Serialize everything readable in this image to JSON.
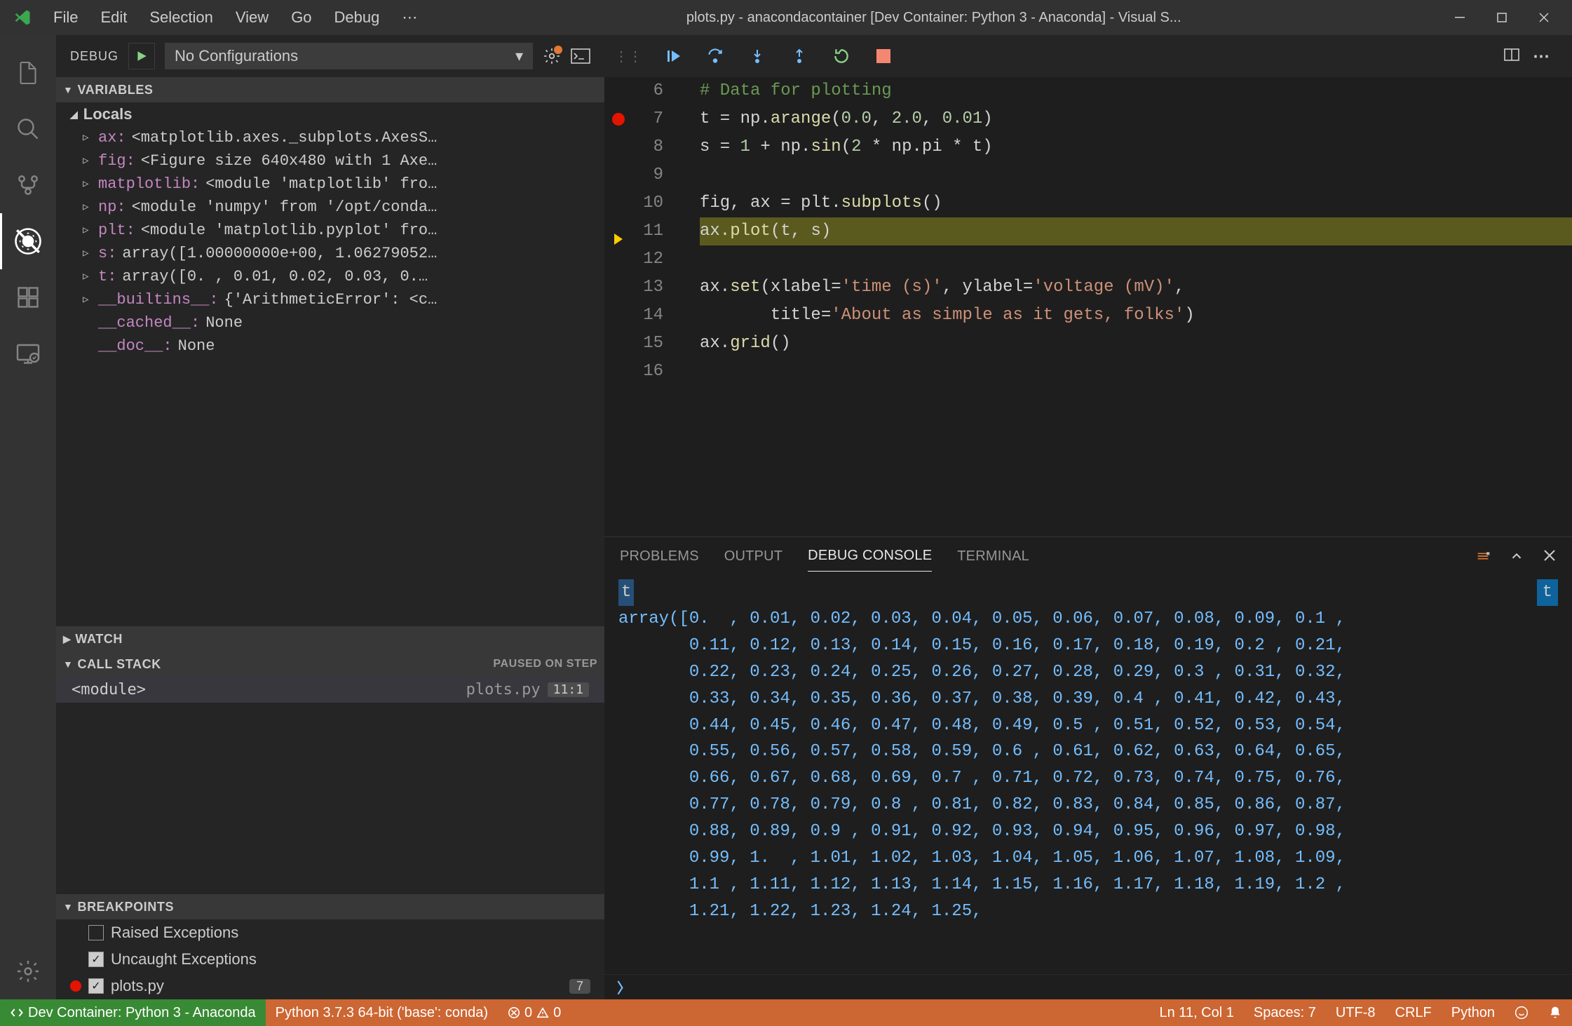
{
  "titlebar": {
    "menu": [
      "File",
      "Edit",
      "Selection",
      "View",
      "Go",
      "Debug"
    ],
    "title": "plots.py - anacondacontainer [Dev Container: Python 3 - Anaconda] - Visual S..."
  },
  "debug_header": {
    "label": "DEBUG",
    "config": "No Configurations"
  },
  "sections": {
    "variables": "VARIABLES",
    "locals": "Locals",
    "watch": "WATCH",
    "callstack": "CALL STACK",
    "callstack_status": "PAUSED ON STEP",
    "breakpoints": "BREAKPOINTS"
  },
  "variables": [
    {
      "expandable": true,
      "name": "ax",
      "value": "<matplotlib.axes._subplots.AxesS…"
    },
    {
      "expandable": true,
      "name": "fig",
      "value": "<Figure size 640x480 with 1 Axe…"
    },
    {
      "expandable": true,
      "name": "matplotlib",
      "value": "<module 'matplotlib' fro…"
    },
    {
      "expandable": true,
      "name": "np",
      "value": "<module 'numpy' from '/opt/conda…"
    },
    {
      "expandable": true,
      "name": "plt",
      "value": "<module 'matplotlib.pyplot' fro…"
    },
    {
      "expandable": true,
      "name": "s",
      "value": "array([1.00000000e+00, 1.06279052…"
    },
    {
      "expandable": true,
      "name": "t",
      "value": "array([0.  , 0.01, 0.02, 0.03, 0.…"
    },
    {
      "expandable": true,
      "name": "__builtins__",
      "value": "{'ArithmeticError': <c…"
    },
    {
      "expandable": false,
      "name": "__cached__",
      "value": "None"
    },
    {
      "expandable": false,
      "name": "__doc__",
      "value": "None"
    }
  ],
  "callstack": [
    {
      "name": "<module>",
      "file": "plots.py",
      "line": "11:1"
    }
  ],
  "breakpoints": {
    "raised": {
      "label": "Raised Exceptions",
      "checked": false
    },
    "uncaught": {
      "label": "Uncaught Exceptions",
      "checked": true
    },
    "file": {
      "label": "plots.py",
      "checked": true,
      "badge": "7"
    }
  },
  "editor": {
    "lines": [
      {
        "n": 6,
        "bp": null,
        "hl": false
      },
      {
        "n": 7,
        "bp": "red",
        "hl": false
      },
      {
        "n": 8,
        "bp": null,
        "hl": false
      },
      {
        "n": 9,
        "bp": null,
        "hl": false
      },
      {
        "n": 10,
        "bp": null,
        "hl": false
      },
      {
        "n": 11,
        "bp": "yellow",
        "hl": true
      },
      {
        "n": 12,
        "bp": null,
        "hl": false
      },
      {
        "n": 13,
        "bp": null,
        "hl": false
      },
      {
        "n": 14,
        "bp": null,
        "hl": false
      },
      {
        "n": 15,
        "bp": null,
        "hl": false
      },
      {
        "n": 16,
        "bp": null,
        "hl": false
      }
    ],
    "code": {
      "l6_comment": "# Data for plotting",
      "l7_a": "t = np.",
      "l7_b": "arange",
      "l7_c": "(",
      "l7_d": "0.0",
      "l7_e": ", ",
      "l7_f": "2.0",
      "l7_g": ", ",
      "l7_h": "0.01",
      "l7_i": ")",
      "l8_a": "s = ",
      "l8_b": "1",
      "l8_c": " + np.",
      "l8_d": "sin",
      "l8_e": "(",
      "l8_f": "2",
      "l8_g": " * np.pi * t)",
      "l10_a": "fig, ax = plt.",
      "l10_b": "subplots",
      "l10_c": "()",
      "l11_a": "ax.",
      "l11_b": "plot",
      "l11_c": "(t, s)",
      "l13_a": "ax.",
      "l13_b": "set",
      "l13_c": "(xlabel=",
      "l13_d": "'time (s)'",
      "l13_e": ", ylabel=",
      "l13_f": "'voltage (mV)'",
      "l13_g": ",",
      "l14_a": "       title=",
      "l14_b": "'About as simple as it gets, folks'",
      "l14_c": ")",
      "l15_a": "ax.",
      "l15_b": "grid",
      "l15_c": "()"
    }
  },
  "panel": {
    "tabs": [
      "PROBLEMS",
      "OUTPUT",
      "DEBUG CONSOLE",
      "TERMINAL"
    ],
    "active_tab": 2,
    "input_var": "t",
    "hint": "t",
    "output": "array([0.  , 0.01, 0.02, 0.03, 0.04, 0.05, 0.06, 0.07, 0.08, 0.09, 0.1 ,\\n       0.11, 0.12, 0.13, 0.14, 0.15, 0.16, 0.17, 0.18, 0.19, 0.2 , 0.21,\\n       0.22, 0.23, 0.24, 0.25, 0.26, 0.27, 0.28, 0.29, 0.3 , 0.31, 0.32,\\n       0.33, 0.34, 0.35, 0.36, 0.37, 0.38, 0.39, 0.4 , 0.41, 0.42, 0.43,\\n       0.44, 0.45, 0.46, 0.47, 0.48, 0.49, 0.5 , 0.51, 0.52, 0.53, 0.54,\\n       0.55, 0.56, 0.57, 0.58, 0.59, 0.6 , 0.61, 0.62, 0.63, 0.64, 0.65,\\n       0.66, 0.67, 0.68, 0.69, 0.7 , 0.71, 0.72, 0.73, 0.74, 0.75, 0.76,\\n       0.77, 0.78, 0.79, 0.8 , 0.81, 0.82, 0.83, 0.84, 0.85, 0.86, 0.87,\\n       0.88, 0.89, 0.9 , 0.91, 0.92, 0.93, 0.94, 0.95, 0.96, 0.97, 0.98,\\n       0.99, 1.  , 1.01, 1.02, 1.03, 1.04, 1.05, 1.06, 1.07, 1.08, 1.09,\\n       1.1 , 1.11, 1.12, 1.13, 1.14, 1.15, 1.16, 1.17, 1.18, 1.19, 1.2 ,\\n       1.21, 1.22, 1.23, 1.24, 1.25,"
  },
  "statusbar": {
    "remote": "Dev Container: Python 3 - Anaconda",
    "python": "Python 3.7.3 64-bit ('base': conda)",
    "errors": "0",
    "warnings": "0",
    "ln_col": "Ln 11, Col 1",
    "spaces": "Spaces: 7",
    "encoding": "UTF-8",
    "eol": "CRLF",
    "lang": "Python"
  }
}
